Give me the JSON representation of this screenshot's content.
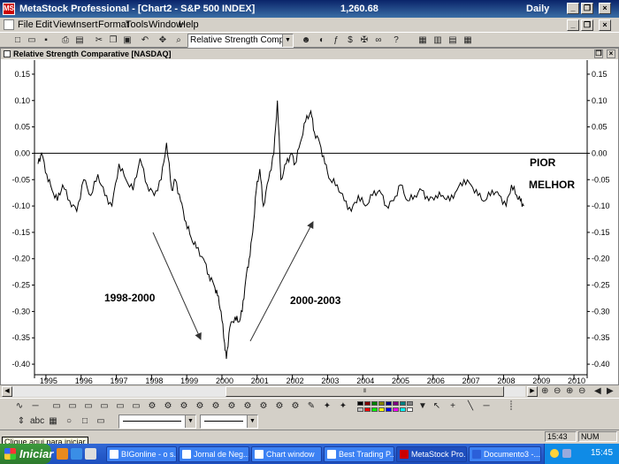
{
  "titlebar": {
    "app_name": "MetaStock Professional - [Chart2 - S&P 500 INDEX]",
    "price": "1,260.68",
    "period": "Daily",
    "icon_text": "MS",
    "buttons": {
      "minimize": "_",
      "restore": "❐",
      "close": "×"
    }
  },
  "menu": {
    "items": [
      "File",
      "Edit",
      "View",
      "Insert",
      "Format",
      "Tools",
      "Window",
      "Help"
    ]
  },
  "toolbar": {
    "indicator_select": "Relative Strength Comparative",
    "icons": [
      "new-icon",
      "open-icon",
      "save-icon",
      "print-icon",
      "print-preview-icon",
      "cut-icon",
      "copy-icon",
      "paste-icon",
      "undo-icon",
      "move-icon",
      "zoom-icon"
    ]
  },
  "chart_window": {
    "title": "Relative Strength Comparative [NASDAQ]",
    "buttons": {
      "restore": "❐",
      "close": "×"
    }
  },
  "chart_data": {
    "type": "line",
    "series": [
      {
        "x": [
          1994.7,
          1994.8,
          1994.95,
          1995.1,
          1995.25,
          1995.4,
          1995.6,
          1995.8,
          1996.0,
          1996.2,
          1996.4,
          1996.6,
          1996.8,
          1997.0,
          1997.2,
          1997.4,
          1997.6,
          1997.8,
          1998.0,
          1998.2,
          1998.35,
          1998.5,
          1998.6,
          1998.75,
          1998.9,
          1999.05,
          1999.2,
          1999.4,
          1999.55,
          1999.7,
          1999.8,
          1999.9,
          2000.0,
          2000.05,
          2000.15,
          2000.3,
          2000.4,
          2000.5,
          2000.6,
          2000.7,
          2000.8,
          2000.9,
          2001.0,
          2001.1,
          2001.25,
          2001.4,
          2001.5,
          2001.6,
          2001.75,
          2001.9,
          2002.0,
          2002.15,
          2002.3,
          2002.45,
          2002.55,
          2002.7,
          2002.85,
          2003.0,
          2003.2,
          2003.4,
          2003.6,
          2003.8,
          2004.0,
          2004.2,
          2004.4,
          2004.6,
          2004.8,
          2005.0,
          2005.2,
          2005.4,
          2005.6,
          2005.8,
          2006.0,
          2006.2,
          2006.4,
          2006.6,
          2006.8,
          2007.0,
          2007.2,
          2007.4,
          2007.6,
          2007.8,
          2008.0,
          2008.15,
          2008.3,
          2008.4,
          2008.5
        ],
        "y": [
          -0.02,
          0.0,
          -0.04,
          -0.07,
          -0.09,
          -0.06,
          -0.09,
          -0.11,
          -0.05,
          -0.08,
          -0.04,
          -0.08,
          -0.1,
          -0.02,
          -0.05,
          -0.07,
          -0.01,
          -0.06,
          -0.08,
          -0.05,
          0.02,
          -0.07,
          -0.05,
          -0.09,
          -0.13,
          -0.16,
          -0.18,
          -0.2,
          -0.23,
          -0.25,
          -0.27,
          -0.3,
          -0.36,
          -0.39,
          -0.33,
          -0.31,
          -0.32,
          -0.3,
          -0.24,
          -0.2,
          -0.15,
          -0.07,
          -0.03,
          -0.1,
          -0.05,
          0.0,
          0.1,
          -0.05,
          -0.02,
          0.0,
          -0.02,
          0.02,
          0.06,
          0.08,
          0.04,
          0.02,
          -0.02,
          -0.05,
          -0.06,
          -0.09,
          -0.11,
          -0.08,
          -0.1,
          -0.08,
          -0.07,
          -0.1,
          -0.09,
          -0.06,
          -0.09,
          -0.08,
          -0.07,
          -0.09,
          -0.08,
          -0.08,
          -0.09,
          -0.07,
          -0.05,
          -0.06,
          -0.08,
          -0.09,
          -0.07,
          -0.08,
          -0.1,
          -0.06,
          -0.08,
          -0.09,
          -0.1
        ]
      }
    ],
    "ylim": [
      -0.42,
      0.17
    ],
    "yticks": [
      "0.15",
      "0.10",
      "0.05",
      "0.00",
      "-0.05",
      "-0.10",
      "-0.15",
      "-0.20",
      "-0.25",
      "-0.30",
      "-0.35",
      "-0.40"
    ],
    "ytick_values": [
      0.15,
      0.1,
      0.05,
      0.0,
      -0.05,
      -0.1,
      -0.15,
      -0.2,
      -0.25,
      -0.3,
      -0.35,
      -0.4
    ],
    "xlim": [
      1994.6,
      2010.3
    ],
    "xticks": [
      "1995",
      "1996",
      "1997",
      "1998",
      "1999",
      "2000",
      "2001",
      "2002",
      "2003",
      "2004",
      "2005",
      "2006",
      "2007",
      "2008",
      "2009",
      "2010"
    ],
    "xtick_values": [
      1995,
      1996,
      1997,
      1998,
      1999,
      2000,
      2001,
      2002,
      2003,
      2004,
      2005,
      2006,
      2007,
      2008,
      2009,
      2010
    ],
    "reference_line": 0.0,
    "annotations": {
      "pior": "PIOR",
      "melhor": "MELHOR",
      "period1": "1998-2000",
      "period2": "2000-2003"
    },
    "grid": false
  },
  "statusbar": {
    "time": "15:43",
    "num": "NUM",
    "tooltip": "Clique aqui para iniciar"
  },
  "taskbar": {
    "start_label": "Iniciar",
    "buttons": [
      "BIGonline - o s...",
      "Jornal de Neg...",
      "Chart window",
      "Best Trading P...",
      "MetaStock Pro...",
      "Documento3 -..."
    ],
    "clock": "15:45"
  },
  "colors": {
    "title_blue": "#0a246a",
    "chart_line": "#000000",
    "taskbar_blue": "#245edb"
  }
}
